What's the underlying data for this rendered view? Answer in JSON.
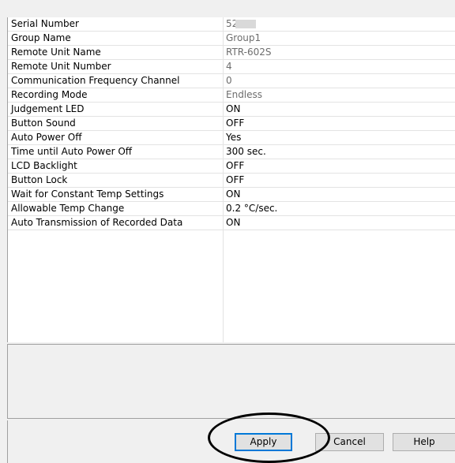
{
  "properties": [
    {
      "name": "Serial Number",
      "value": "52",
      "readonly": true
    },
    {
      "name": "Group Name",
      "value": "Group1",
      "readonly": true
    },
    {
      "name": "Remote Unit Name",
      "value": "RTR-602S",
      "readonly": true
    },
    {
      "name": "Remote Unit Number",
      "value": "4",
      "readonly": true
    },
    {
      "name": "Communication Frequency Channel",
      "value": "0",
      "readonly": true
    },
    {
      "name": "Recording Mode",
      "value": "Endless",
      "readonly": true
    },
    {
      "name": "Judgement LED",
      "value": "ON",
      "readonly": false
    },
    {
      "name": "Button Sound",
      "value": "OFF",
      "readonly": false
    },
    {
      "name": "Auto Power Off",
      "value": "Yes",
      "readonly": false
    },
    {
      "name": "Time until Auto Power Off",
      "value": "300 sec.",
      "readonly": false
    },
    {
      "name": "LCD Backlight",
      "value": "OFF",
      "readonly": false
    },
    {
      "name": "Button Lock",
      "value": "OFF",
      "readonly": false
    },
    {
      "name": "Wait for Constant Temp Settings",
      "value": "ON",
      "readonly": false
    },
    {
      "name": "Allowable Temp Change",
      "value": "0.2 °C/sec.",
      "readonly": false
    },
    {
      "name": "Auto Transmission of Recorded Data",
      "value": "ON",
      "readonly": false
    }
  ],
  "buttons": {
    "apply": "Apply",
    "cancel": "Cancel",
    "help": "Help"
  }
}
